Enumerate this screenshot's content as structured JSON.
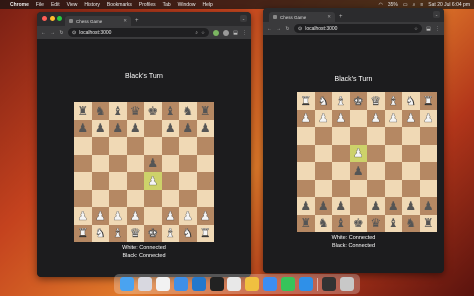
{
  "menubar": {
    "apple": "",
    "app": "Chrome",
    "items": [
      "File",
      "Edit",
      "View",
      "History",
      "Bookmarks",
      "Profiles",
      "Tab",
      "Window",
      "Help"
    ],
    "battery": "35%",
    "datetime": "Sat 20 Jul 6:04 pm"
  },
  "left_window": {
    "tab_title": "Chess Game",
    "url": "localhost:3000",
    "turn_text": "Black's Turn",
    "status_white": "White: Connected",
    "status_black": "Black: Connected",
    "highlight": [
      [
        4,
        4
      ]
    ],
    "board": [
      [
        "bR",
        "bN",
        "bB",
        "bQ",
        "bK",
        "bB",
        "bN",
        "bR"
      ],
      [
        "bP",
        "bP",
        "bP",
        "bP",
        "",
        "bP",
        "bP",
        "bP"
      ],
      [
        "",
        "",
        "",
        "",
        "",
        "",
        "",
        ""
      ],
      [
        "",
        "",
        "",
        "",
        "bP",
        "",
        "",
        ""
      ],
      [
        "",
        "",
        "",
        "",
        "wP",
        "",
        "",
        ""
      ],
      [
        "",
        "",
        "",
        "",
        "",
        "",
        "",
        ""
      ],
      [
        "wP",
        "wP",
        "wP",
        "wP",
        "",
        "wP",
        "wP",
        "wP"
      ],
      [
        "wR",
        "wN",
        "wB",
        "wQ",
        "wK",
        "wB",
        "wN",
        "wR"
      ]
    ]
  },
  "right_window": {
    "tab_title": "Chess Game",
    "url": "localhost:3000",
    "turn_text": "Black's Turn",
    "status_white": "White: Connected",
    "status_black": "Black: Connected",
    "highlight": [
      [
        3,
        3
      ]
    ],
    "board": [
      [
        "wR",
        "wN",
        "wB",
        "wK",
        "wQ",
        "wB",
        "wN",
        "wR"
      ],
      [
        "wP",
        "wP",
        "wP",
        "",
        "wP",
        "wP",
        "wP",
        "wP"
      ],
      [
        "",
        "",
        "",
        "",
        "",
        "",
        "",
        ""
      ],
      [
        "",
        "",
        "",
        "wP",
        "",
        "",
        "",
        ""
      ],
      [
        "",
        "",
        "",
        "bP",
        "",
        "",
        "",
        ""
      ],
      [
        "",
        "",
        "",
        "",
        "",
        "",
        "",
        ""
      ],
      [
        "bP",
        "bP",
        "bP",
        "",
        "bP",
        "bP",
        "bP",
        "bP"
      ],
      [
        "bR",
        "bN",
        "bB",
        "bK",
        "bQ",
        "bB",
        "bN",
        "bR"
      ]
    ]
  },
  "dock": {
    "icons": [
      "finder-icon",
      "launchpad-icon",
      "chatgpt-icon",
      "xcode-icon",
      "vscode-icon",
      "terminal-icon",
      "chrome-icon",
      "chrome-canary-icon",
      "mail-icon",
      "messages-icon",
      "safari-icon",
      "screen-icon",
      "trash-icon"
    ]
  },
  "colors": {
    "light_square": "#f0d9b5",
    "dark_square": "#b58863",
    "highlight_square": "#cdd26a"
  }
}
